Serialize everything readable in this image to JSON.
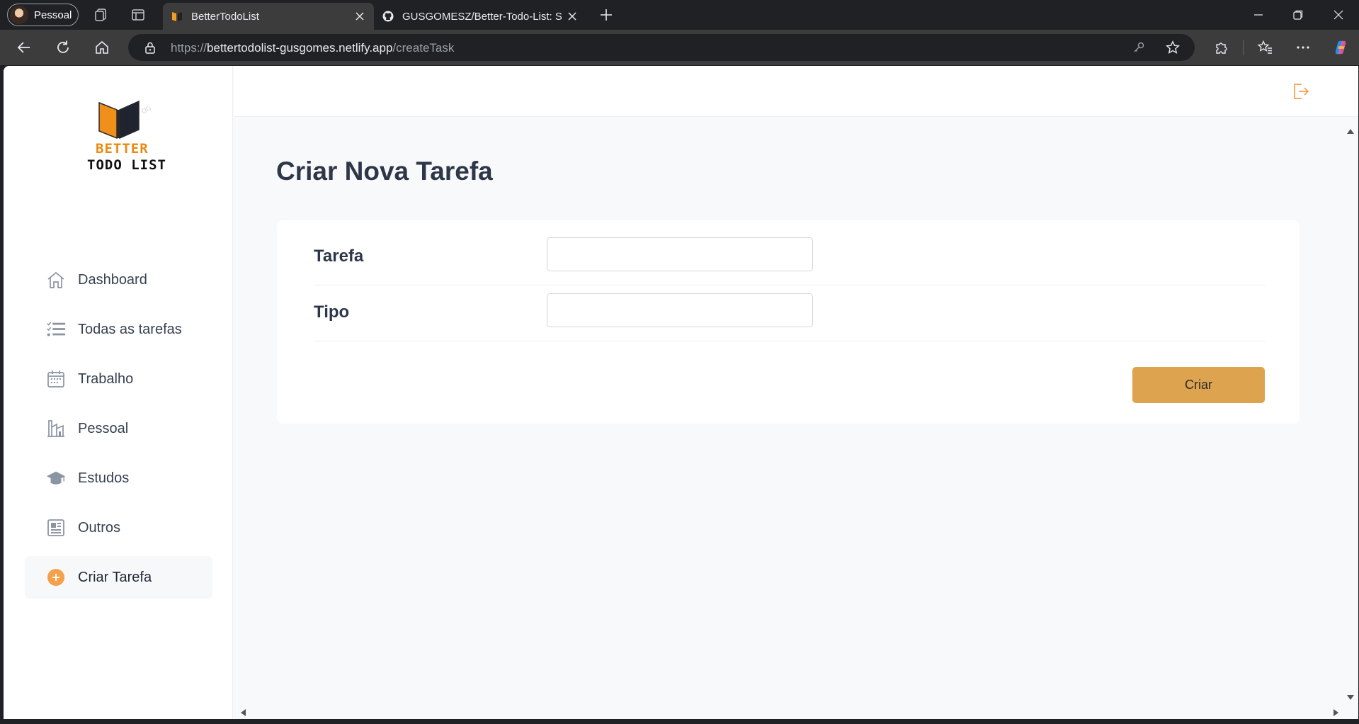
{
  "browser": {
    "profile_label": "Pessoal",
    "tabs": [
      {
        "title": "BetterTodoList",
        "active": true
      },
      {
        "title": "GUSGOMESZ/Better-Todo-List: Sc",
        "active": false
      }
    ],
    "url_scheme": "https://",
    "url_host": "bettertodolist-gusgomes.netlify.app",
    "url_path": "/createTask"
  },
  "app": {
    "logo": {
      "line1": "BETTER",
      "line2": "TODO LIST"
    },
    "nav": [
      {
        "label": "Dashboard",
        "icon": "home-icon"
      },
      {
        "label": "Todas as tarefas",
        "icon": "list-icon"
      },
      {
        "label": "Trabalho",
        "icon": "calendar-icon"
      },
      {
        "label": "Pessoal",
        "icon": "building-icon"
      },
      {
        "label": "Estudos",
        "icon": "graduation-cap-icon"
      },
      {
        "label": "Outros",
        "icon": "gallery-icon"
      },
      {
        "label": "Criar Tarefa",
        "icon": "plus-circle-icon",
        "active": true
      }
    ],
    "page_title": "Criar Nova Tarefa",
    "form": {
      "task_label": "Tarefa",
      "task_value": "",
      "type_label": "Tipo",
      "type_value": "",
      "submit_label": "Criar"
    }
  },
  "colors": {
    "accent": "#dda34f",
    "logo_orange": "#e88a10",
    "logout_icon": "#f5a04a",
    "title_text": "#2d3748"
  }
}
